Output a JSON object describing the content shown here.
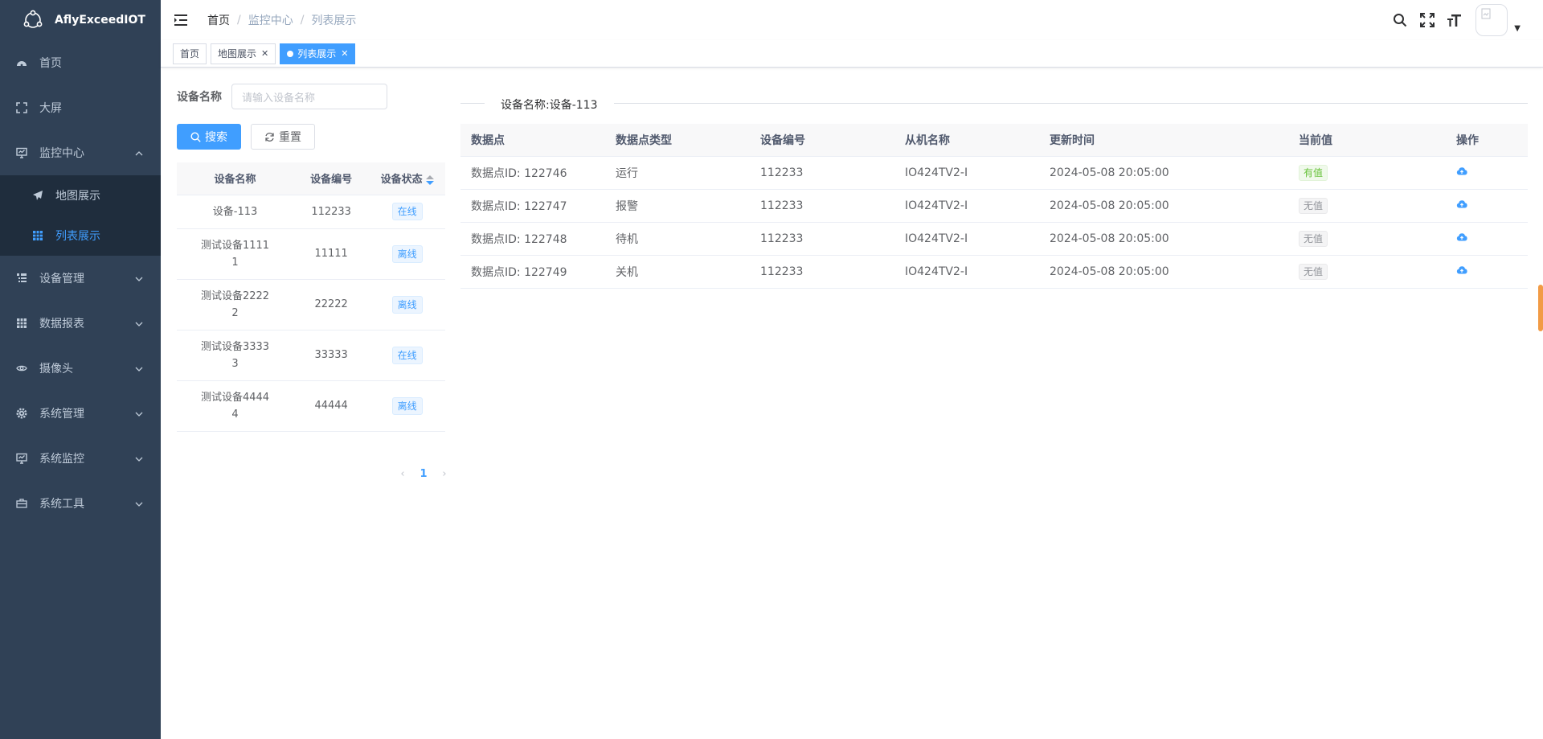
{
  "app": {
    "title": "AflyExceedIOT"
  },
  "sidebar": {
    "items": [
      {
        "label": "首页",
        "icon": "dashboard-icon"
      },
      {
        "label": "大屏",
        "icon": "fullscreen-icon"
      },
      {
        "label": "监控中心",
        "icon": "monitor-icon",
        "expanded": true,
        "children": [
          {
            "label": "地图展示",
            "icon": "send-icon"
          },
          {
            "label": "列表展示",
            "icon": "table-icon",
            "active": true
          }
        ]
      },
      {
        "label": "设备管理",
        "icon": "tree-table-icon"
      },
      {
        "label": "数据报表",
        "icon": "grid-icon"
      },
      {
        "label": "摄像头",
        "icon": "eye-icon"
      },
      {
        "label": "系统管理",
        "icon": "system-icon"
      },
      {
        "label": "系统监控",
        "icon": "monitor-icon"
      },
      {
        "label": "系统工具",
        "icon": "toolbox-icon"
      }
    ]
  },
  "breadcrumb": [
    "首页",
    "监控中心",
    "列表展示"
  ],
  "tags": [
    {
      "label": "首页",
      "closable": false
    },
    {
      "label": "地图展示",
      "closable": true
    },
    {
      "label": "列表展示",
      "closable": true,
      "active": true
    }
  ],
  "search": {
    "label": "设备名称",
    "placeholder": "请输入设备名称",
    "search_btn": "搜索",
    "reset_btn": "重置"
  },
  "device_table": {
    "columns": [
      "设备名称",
      "设备编号",
      "设备状态"
    ],
    "rows": [
      {
        "name": "设备-113",
        "code": "112233",
        "status": "在线"
      },
      {
        "name": "测试设备1111\n1",
        "name_l1": "测试设备1111",
        "name_l2": "1",
        "code": "11111",
        "status": "离线"
      },
      {
        "name_l1": "测试设备2222",
        "name_l2": "2",
        "code": "22222",
        "status": "离线"
      },
      {
        "name_l1": "测试设备3333",
        "name_l2": "3",
        "code": "33333",
        "status": "在线"
      },
      {
        "name_l1": "测试设备4444",
        "name_l2": "4",
        "code": "44444",
        "status": "离线"
      }
    ]
  },
  "pager": {
    "current": "1"
  },
  "detail": {
    "title": "设备名称:设备-113",
    "columns": [
      "数据点",
      "数据点类型",
      "设备编号",
      "从机名称",
      "更新时间",
      "当前值",
      "操作"
    ],
    "rows": [
      {
        "point": "数据点ID: 122746",
        "type": "运行",
        "code": "112233",
        "slave": "IO424TV2-I",
        "time": "2024-05-08 20:05:00",
        "value": "有值",
        "has": true
      },
      {
        "point": "数据点ID: 122747",
        "type": "报警",
        "code": "112233",
        "slave": "IO424TV2-I",
        "time": "2024-05-08 20:05:00",
        "value": "无值",
        "has": false
      },
      {
        "point": "数据点ID: 122748",
        "type": "待机",
        "code": "112233",
        "slave": "IO424TV2-I",
        "time": "2024-05-08 20:05:00",
        "value": "无值",
        "has": false
      },
      {
        "point": "数据点ID: 122749",
        "type": "关机",
        "code": "112233",
        "slave": "IO424TV2-I",
        "time": "2024-05-08 20:05:00",
        "value": "无值",
        "has": false
      }
    ]
  },
  "colors": {
    "sidebar_bg": "#304156",
    "submenu_bg": "#1f2d3d",
    "accent": "#409eff",
    "success": "#67c23a"
  }
}
